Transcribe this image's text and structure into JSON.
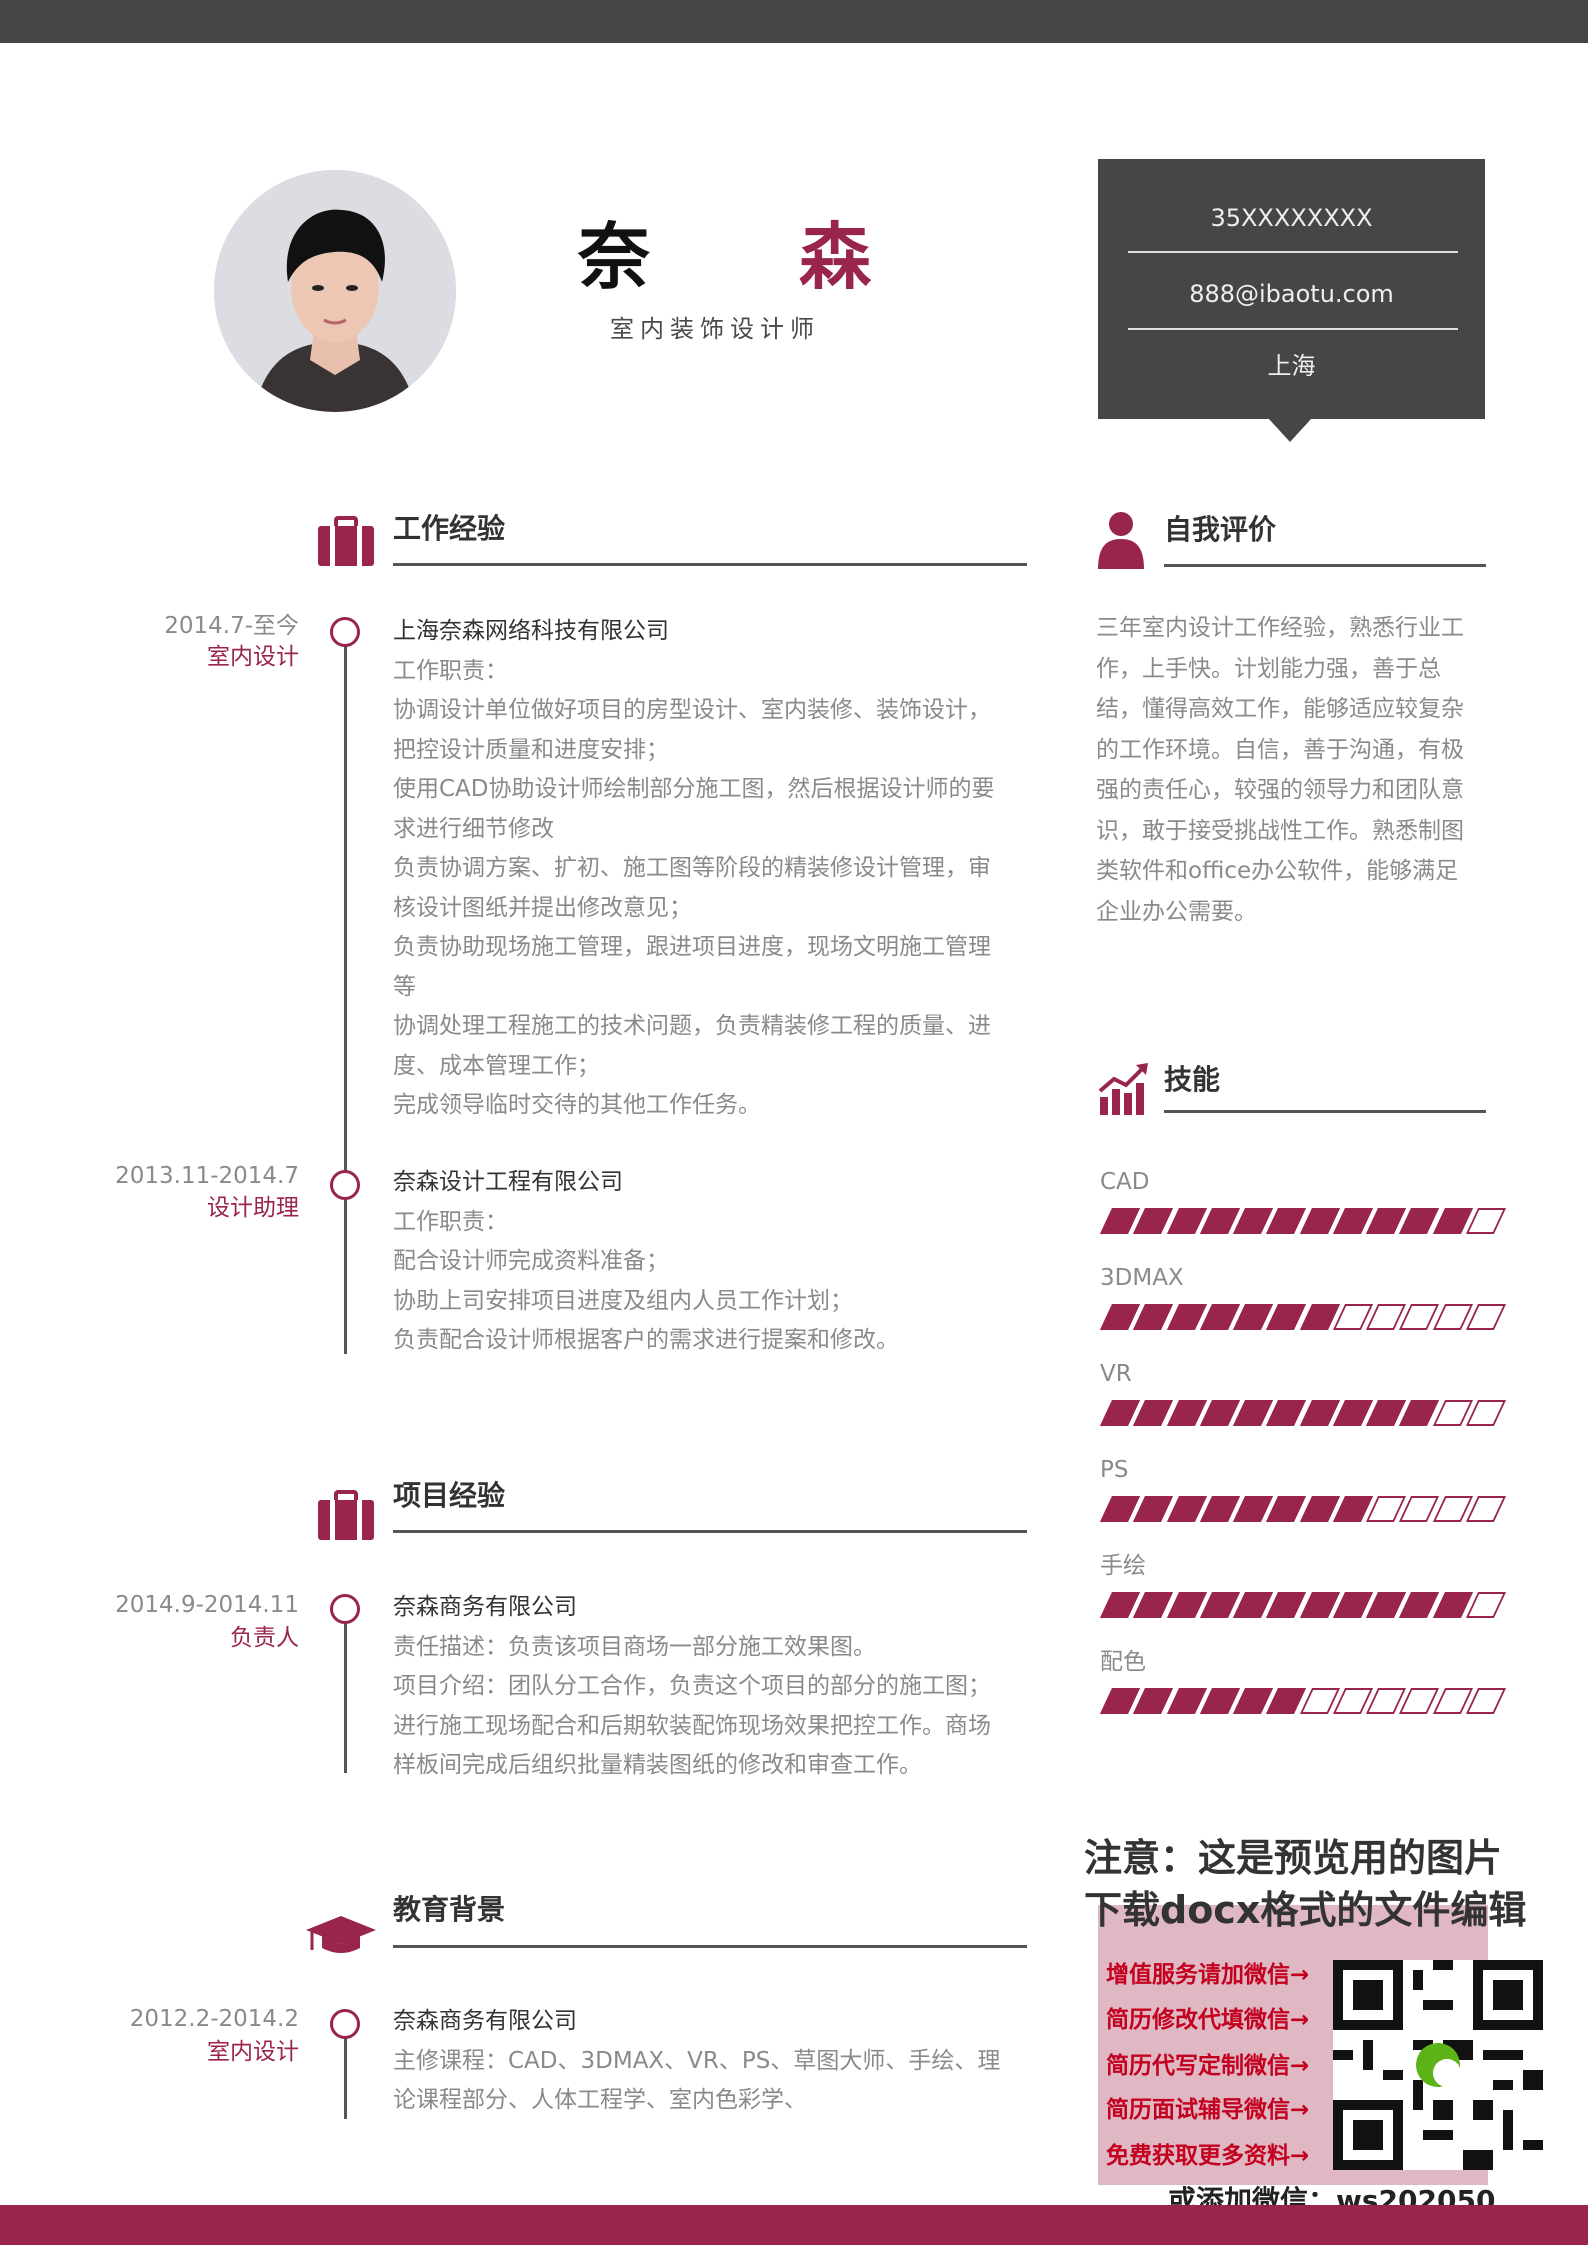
{
  "header": {
    "name_first": "奈",
    "name_second": "森",
    "job_title": "室内装饰设计师"
  },
  "contact": {
    "phone": "35XXXXXXXX",
    "email": "888@ibaotu.com",
    "city": "上海"
  },
  "sections": {
    "work": "工作经验",
    "projects": "项目经验",
    "education": "教育背景",
    "self": "自我评价",
    "skills": "技能"
  },
  "work": [
    {
      "date": "2014.7-至今",
      "role": "室内设计",
      "company": "上海奈森网络科技有限公司",
      "lines": [
        "工作职责：",
        "协调设计单位做好项目的房型设计、室内装修、装饰设计，",
        "把控设计质量和进度安排；",
        "使用CAD协助设计师绘制部分施工图，然后根据设计师的要",
        "求进行细节修改",
        "负责协调方案、扩初、施工图等阶段的精装修设计管理，审",
        "核设计图纸并提出修改意见；",
        "负责协助现场施工管理，跟进项目进度，现场文明施工管理",
        "等",
        "协调处理工程施工的技术问题，负责精装修工程的质量、进",
        "度、成本管理工作；",
        "完成领导临时交待的其他工作任务。"
      ]
    },
    {
      "date": "2013.11-2014.7",
      "role": "设计助理",
      "company": "奈森设计工程有限公司",
      "lines": [
        "工作职责：",
        "配合设计师完成资料准备；",
        "协助上司安排项目进度及组内人员工作计划；",
        "负责配合设计师根据客户的需求进行提案和修改。"
      ]
    }
  ],
  "projects": [
    {
      "date": "2014.9-2014.11",
      "role": "负责人",
      "company": "奈森商务有限公司",
      "lines": [
        "责任描述：负责该项目商场一部分施工效果图。",
        "项目介绍：团队分工合作，负责这个项目的部分的施工图；",
        "进行施工现场配合和后期软装配饰现场效果把控工作。商场",
        "样板间完成后组织批量精装图纸的修改和审查工作。"
      ]
    }
  ],
  "education": [
    {
      "date": "2012.2-2014.2",
      "role": "室内设计",
      "company": "奈森商务有限公司",
      "lines": [
        "主修课程：CAD、3DMAX、VR、PS、草图大师、手绘、理",
        "论课程部分、人体工程学、室内色彩学、"
      ]
    }
  ],
  "self_eval": [
    "三年室内设计工作经验，熟悉行业工",
    "作，上手快。计划能力强，善于总",
    "结，懂得高效工作，能够适应较复杂",
    "的工作环境。自信，善于沟通，有极",
    "强的责任心，较强的领导力和团队意",
    "识，敢于接受挑战性工作。熟悉制图",
    "类软件和office办公软件，能够满足",
    "企业办公需要。"
  ],
  "skills": [
    {
      "name": "CAD",
      "level": 11,
      "max": 12
    },
    {
      "name": "3DMAX",
      "level": 7,
      "max": 12
    },
    {
      "name": "VR",
      "level": 10,
      "max": 12
    },
    {
      "name": "PS",
      "level": 8,
      "max": 12
    },
    {
      "name": "手绘",
      "level": 11,
      "max": 12
    },
    {
      "name": "配色",
      "level": 6,
      "max": 12
    }
  ],
  "ad": {
    "note_1": "注意：这是预览用的图片",
    "note_2": "下载docx格式的文件编辑",
    "items": [
      "增值服务请加微信→",
      "简历修改代填微信→",
      "简历代写定制微信→",
      "简历面试辅导微信→",
      "免费获取更多资料→"
    ],
    "footer": "或添加微信：ws202050"
  },
  "colors": {
    "accent": "#99264a",
    "dark": "#464646",
    "muted_text": "#8a8a8a"
  }
}
